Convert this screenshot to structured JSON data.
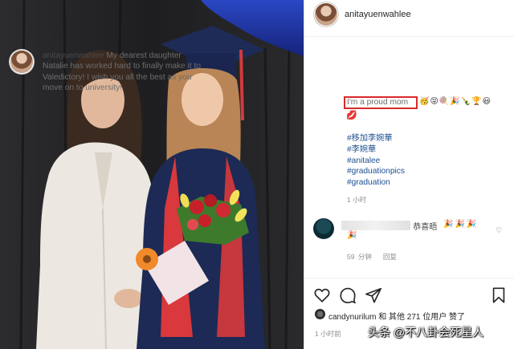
{
  "post": {
    "username": "anitayuenwahlee",
    "caption_user": "anitayuenwahlee",
    "caption_text": "My dearest daughter Natalie has worked hard to finally make it to Valedictory! I wish you all the best as you move on to university!",
    "proud_text": "I'm a proud mom",
    "emojis": "🥳😝🍭🎉🍾🏆😃",
    "lips_emoji": "💋",
    "hashtags": [
      "#移加李婉華",
      "#李婉華",
      "#anitalee",
      "#graduationpics",
      "#graduation"
    ],
    "time_ago": "1 小时"
  },
  "comment": {
    "name": "恭喜晤",
    "emoji_line1": "🎉🎉🎉",
    "emoji_line2": "🎉",
    "likes": "59 分钟",
    "reply": "回复"
  },
  "likes_line": "candynurilum 和 其他 271 位用户 赞了",
  "time_posted": "1 小时前",
  "watermark": "头条 @不八卦会死星人",
  "icons": {
    "like": "heart-icon",
    "comment": "comment-icon",
    "share": "share-icon",
    "save": "bookmark-icon"
  },
  "colors": {
    "highlight_box": "#d92b2b",
    "hashtag": "#1d4f91",
    "gown": "#1c2a55",
    "stole": "#d9383c"
  }
}
